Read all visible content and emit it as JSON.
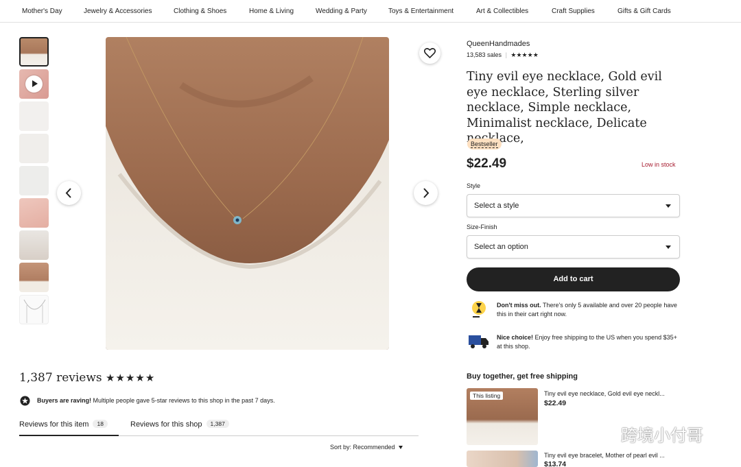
{
  "nav": {
    "items": [
      "Mother's Day",
      "Jewelry & Accessories",
      "Clothing & Shoes",
      "Home & Living",
      "Wedding & Party",
      "Toys & Entertainment",
      "Art & Collectibles",
      "Craft Supplies",
      "Gifts & Gift Cards"
    ]
  },
  "gallery": {
    "thumbnail_count": 9,
    "active_index": 0,
    "video_thumbnail_index": 1
  },
  "shop": {
    "name": "QueenHandmades",
    "sales": "13,583 sales",
    "rating_stars": "★★★★★"
  },
  "listing": {
    "title": "Tiny evil eye necklace, Gold evil eye necklace, Sterling silver necklace, Simple necklace, Minimalist necklace, Delicate necklace,",
    "badge": "Bestseller",
    "price": "$22.49",
    "stock_status": "Low in stock"
  },
  "options": {
    "style_label": "Style",
    "style_value": "Select a style",
    "size_label": "Size-Finish",
    "size_value": "Select an option"
  },
  "cart_button": "Add to cart",
  "notices": {
    "dont_miss_bold": "Don't miss out.",
    "dont_miss_text": " There's only 5 available and over 20 people have this in their cart right now.",
    "shipping_bold": "Nice choice!",
    "shipping_text": " Enjoy free shipping to the US when you spend $35+ at this shop."
  },
  "bundle": {
    "title": "Buy together, get free shipping",
    "items": [
      {
        "tag": "This listing",
        "name": "Tiny evil eye necklace, Gold evil eye neckl...",
        "price": "$22.49"
      },
      {
        "name": "Tiny evil eye bracelet, Mother of pearl evil ...",
        "price": "$13.74"
      }
    ]
  },
  "reviews": {
    "count_label": "1,387 reviews",
    "stars": "★★★★★",
    "raving_bold": "Buyers are raving!",
    "raving_text": " Multiple people gave 5-star reviews to this shop in the past 7 days.",
    "tab_item_label": "Reviews for this item",
    "tab_item_count": "18",
    "tab_shop_label": "Reviews for this shop",
    "tab_shop_count": "1,387",
    "sort_label": "Sort by: Recommended"
  },
  "watermark": "跨境小付哥",
  "colors": {
    "text": "#222222",
    "badge_bg": "#fde0c1",
    "stock_red": "#a61a2e",
    "cart_button_bg": "#222222"
  }
}
